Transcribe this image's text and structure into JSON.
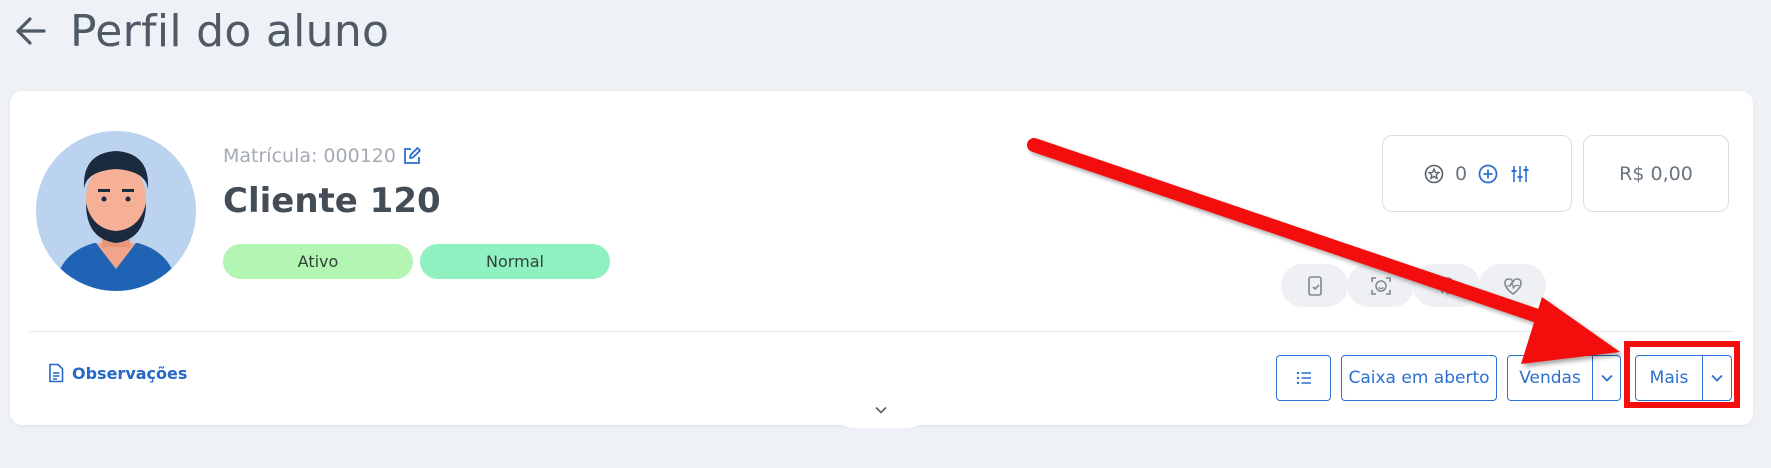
{
  "page": {
    "title": "Perfil do aluno"
  },
  "student": {
    "matricula_label": "Matrícula: 000120",
    "name": "Cliente 120",
    "status_badges": [
      "Ativo",
      "Normal"
    ]
  },
  "summary": {
    "points": "0",
    "balance": "R$ 0,00"
  },
  "quick_actions": [
    "app-icon",
    "face-recognition-icon",
    "fingerprint-icon",
    "health-heart-icon"
  ],
  "footer": {
    "observacoes": "Observações",
    "caixa": "Caixa em aberto",
    "vendas": "Vendas",
    "mais": "Mais"
  },
  "colors": {
    "accent": "#2b6fd1",
    "badge_ativo": "#b3f5b2",
    "badge_normal": "#8ff0c0",
    "annotation": "#f40e0e"
  }
}
